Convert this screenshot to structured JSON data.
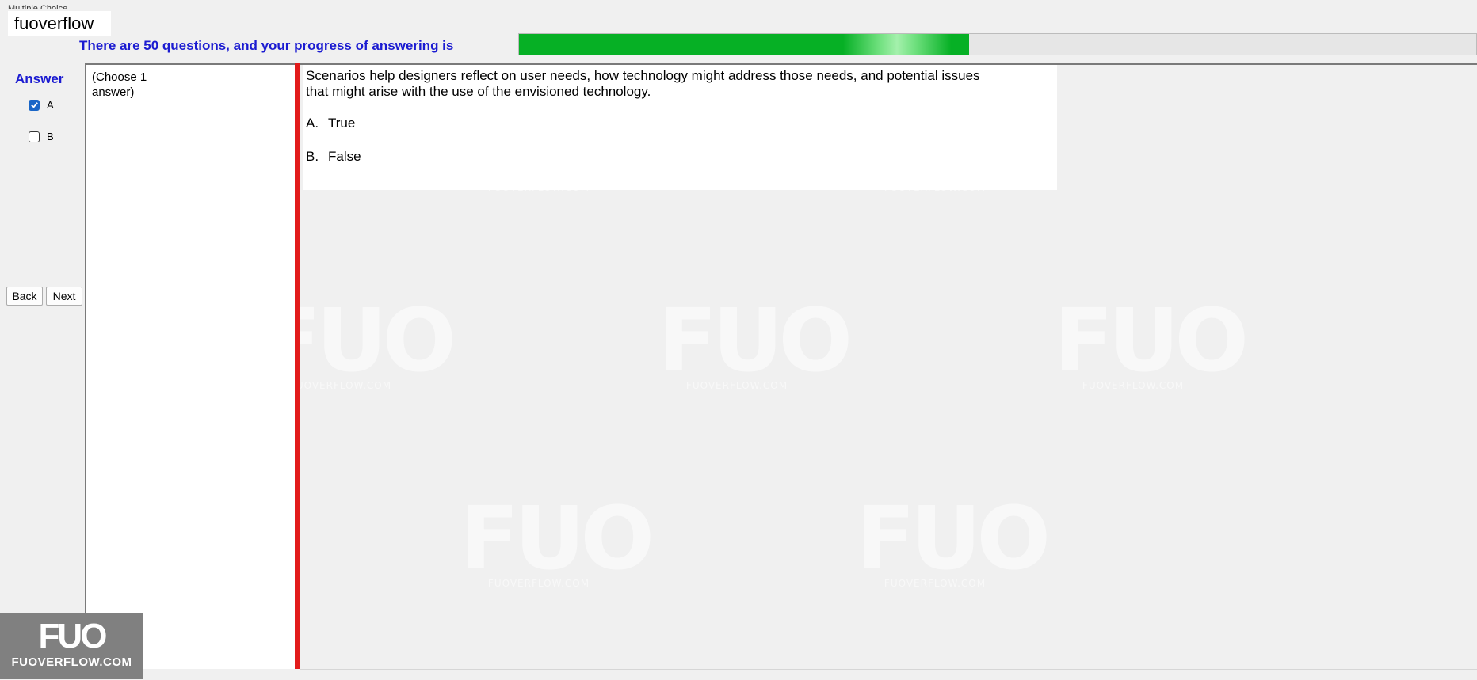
{
  "window": {
    "title_cut": "Multiple Choice",
    "label": "fuoverflow"
  },
  "progress": {
    "label": "There are 50 questions, and your progress of answering is",
    "value_fraction": 0.47
  },
  "answer_panel": {
    "title": "Answer",
    "options": [
      {
        "label": "A",
        "checked": true
      },
      {
        "label": "B",
        "checked": false
      }
    ],
    "back_label": "Back",
    "next_label": "Next"
  },
  "instruction": "(Choose 1 answer)",
  "question": {
    "text": "Scenarios help designers reflect on user needs, how technology might address those needs, and potential issues that might arise with the use of the envisioned technology.",
    "options": [
      {
        "letter": "A.",
        "text": "True"
      },
      {
        "letter": "B.",
        "text": "False"
      }
    ]
  },
  "watermark": {
    "big": "FUO",
    "small": "FUOVERFLOW.COM"
  },
  "logo": {
    "big": "FUO",
    "small": "FUOVERFLOW.COM"
  },
  "colors": {
    "accent_blue": "#1b1bd1",
    "progress_green": "#06b025",
    "divider_red": "#e21b1b",
    "checkbox_blue": "#1a66c7"
  }
}
